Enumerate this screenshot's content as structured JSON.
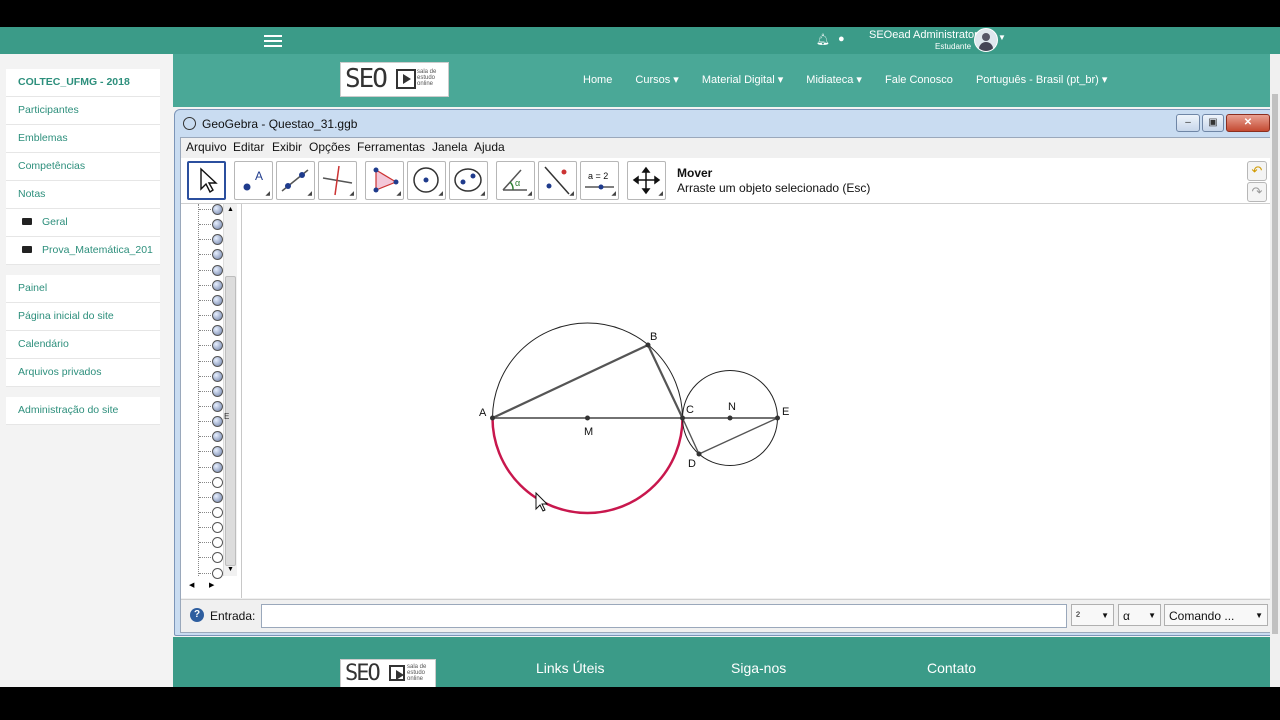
{
  "topbar": {
    "user_name": "SEOead Administrator",
    "user_role": "Estudante"
  },
  "site_header": {
    "logo_letters": "SEO",
    "logo_subtitle": "sala de estudo online",
    "nav": [
      "Home",
      "Cursos ▾",
      "Material Digital ▾",
      "Midiateca ▾",
      "Fale Conosco",
      "Português - Brasil (pt_br) ▾"
    ]
  },
  "sidebar": {
    "group1": [
      "COLTEC_UFMG - 2018",
      "Participantes",
      "Emblemas",
      "Competências",
      "Notas"
    ],
    "folders": [
      "Geral",
      "Prova_Matemática_201"
    ],
    "group2": [
      "Painel",
      "Página inicial do site",
      "Calendário",
      "Arquivos privados"
    ],
    "group3": [
      "Administração do site"
    ]
  },
  "geogebra": {
    "title": "GeoGebra - Questao_31.ggb",
    "menu": [
      "Arquivo",
      "Editar",
      "Exibir",
      "Opções",
      "Ferramentas",
      "Janela",
      "Ajuda"
    ],
    "tool_name": "Mover",
    "tool_description": "Arraste um objeto selecionado (Esc)",
    "slider_tool_label": "a = 2",
    "input_label": "Entrada:",
    "combo_exponent": "²",
    "combo_alpha": "α",
    "combo_command": "Comando ...",
    "algebra_letter": "E",
    "points": {
      "A": "A",
      "B": "B",
      "C": "C",
      "D": "D",
      "E": "E",
      "M": "M",
      "N": "N"
    },
    "accent_arc_color": "#c8174d"
  },
  "footer": {
    "logo_letters": "SEO",
    "logo_subtitle": "sala de estudo online",
    "links": [
      "Links Úteis",
      "Siga-nos",
      "Contato"
    ]
  }
}
